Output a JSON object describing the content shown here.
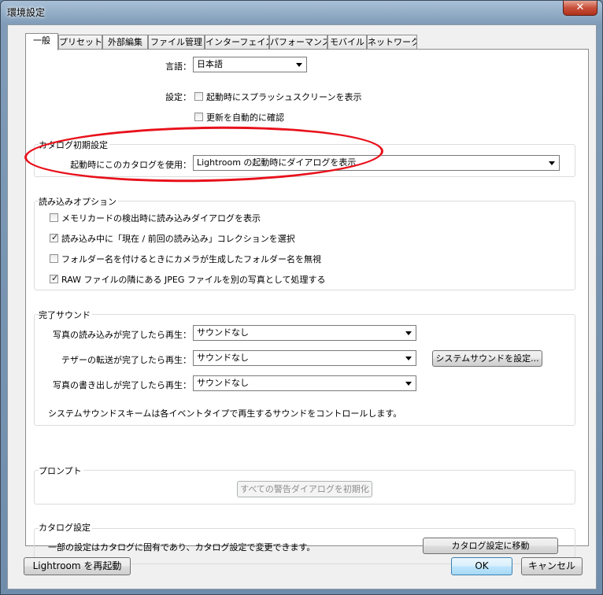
{
  "window": {
    "title": "環境設定",
    "close_glyph": "✕"
  },
  "tabs": [
    {
      "label": "一般",
      "active": true
    },
    {
      "label": "プリセット",
      "active": false
    },
    {
      "label": "外部編集",
      "active": false
    },
    {
      "label": "ファイル管理",
      "active": false
    },
    {
      "label": "インターフェイス",
      "active": false
    },
    {
      "label": "パフォーマンス",
      "active": false
    },
    {
      "label": "モバイル",
      "active": false
    },
    {
      "label": "ネットワーク",
      "active": false
    }
  ],
  "general": {
    "language_label": "言語：",
    "language_value": "日本語",
    "settings_label": "設定：",
    "splash_label": "起動時にスプラッシュスクリーンを表示",
    "splash_checked": false,
    "updates_label": "更新を自動的に確認",
    "updates_checked": false
  },
  "catalog_default": {
    "title": "カタログ初期設定",
    "use_label": "起動時にこのカタログを使用：",
    "use_value": "Lightroom の起動時にダイアログを表示"
  },
  "import_options": {
    "title": "読み込みオプション",
    "items": [
      {
        "label": "メモリカードの検出時に読み込みダイアログを表示",
        "checked": false
      },
      {
        "label": "読み込み中に「現在 / 前回の読み込み」コレクションを選択",
        "checked": true
      },
      {
        "label": "フォルダー名を付けるときにカメラが生成したフォルダー名を無視",
        "checked": false
      },
      {
        "label": "RAW ファイルの隣にある JPEG ファイルを別の写真として処理する",
        "checked": true
      }
    ]
  },
  "completion_sounds": {
    "title": "完了サウンド",
    "import_label": "写真の読み込みが完了したら再生：",
    "import_value": "サウンドなし",
    "tether_label": "テザーの転送が完了したら再生：",
    "tether_value": "サウンドなし",
    "export_label": "写真の書き出しが完了したら再生：",
    "export_value": "サウンドなし",
    "system_sound_button": "システムサウンドを設定...",
    "note": "システムサウンドスキームは各イベントタイプで再生するサウンドをコントロールします。"
  },
  "prompts": {
    "title": "プロンプト",
    "reset_button": "すべての警告ダイアログを初期化"
  },
  "catalog_settings": {
    "title": "カタログ設定",
    "note": "一部の設定はカタログに固有であり、カタログ設定で変更できます。",
    "goto_button": "カタログ設定に移動"
  },
  "footer": {
    "restart_button": "Lightroom を再起動",
    "ok_button": "OK",
    "cancel_button": "キャンセル"
  },
  "check_glyph": "✓",
  "annotation_color": "#e8101a"
}
